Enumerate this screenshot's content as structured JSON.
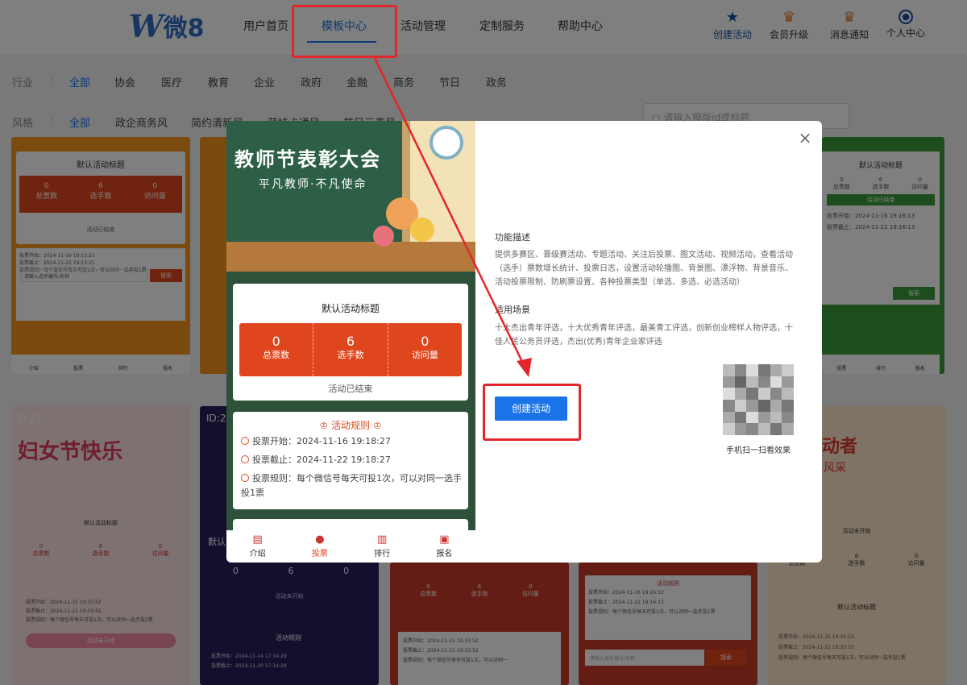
{
  "logo": {
    "mark": "W",
    "text": "微8"
  },
  "nav": {
    "items": [
      {
        "label": "用户首页"
      },
      {
        "label": "模板中心"
      },
      {
        "label": "活动管理"
      },
      {
        "label": "定制服务"
      },
      {
        "label": "帮助中心"
      }
    ]
  },
  "top_right": {
    "items": [
      {
        "label": "创建活动",
        "icon": "star-icon"
      },
      {
        "label": "会员升级",
        "icon": "crown-icon"
      },
      {
        "label": "消息通知",
        "icon": "bell-icon"
      },
      {
        "label": "个人中心",
        "icon": "user-icon"
      }
    ]
  },
  "filters": {
    "industry": {
      "label": "行业",
      "options": [
        "全部",
        "协会",
        "医疗",
        "教育",
        "企业",
        "政府",
        "金融",
        "商务",
        "节日",
        "政务"
      ]
    },
    "style": {
      "label": "风格",
      "options": [
        "全部",
        "政企商务风",
        "简约清新风",
        "萌娃卡通风",
        "节日元素风"
      ]
    },
    "search_placeholder": "请输入模版id或标题"
  },
  "background_cards": {
    "card1": {
      "title": "默认活动标题",
      "stats": [
        {
          "num": "0",
          "label": "总票数"
        },
        {
          "num": "6",
          "label": "选手数"
        },
        {
          "num": "0",
          "label": "访问量"
        }
      ],
      "status": "活动已结束",
      "start": "投票开始：2024-11-16 19:13:21",
      "end": "投票截止：2024-11-22 19:13:21",
      "rule": "投票规则：每个微信号每天可投1次，可以对同一选手投1票",
      "search_ph": "请输入选手编号/名称",
      "search_btn": "搜索",
      "nav": [
        "介绍",
        "投票",
        "排行",
        "报名"
      ]
    },
    "card_id21": {
      "id": "ID:21",
      "banner": "妇女节快乐",
      "title": "默认活动标题",
      "stats": [
        {
          "num": "0",
          "label": "总票数"
        },
        {
          "num": "6",
          "label": "选手数"
        },
        {
          "num": "0",
          "label": "访问量"
        }
      ],
      "start": "投票开始：2024-11-15 10:33:52",
      "end": "投票截止：2024-11-21 10:33:52",
      "rule": "投票规则：每个微信号每天可投1次，可以对同一选手投1票",
      "status": "活动未开始"
    },
    "card_id2": {
      "id": "ID:2",
      "label": "默认",
      "stats": [
        "0",
        "6",
        "0"
      ],
      "status": "活动未开始",
      "rules_title": "活动规则",
      "start": "投票开始：2024-11-14 17:14:29",
      "end": "投票截止：2024-11-20 17:14:29"
    },
    "card_mid": {
      "stats": [
        {
          "num": "0",
          "label": "总票数"
        },
        {
          "num": "6",
          "label": "选手数"
        },
        {
          "num": "0",
          "label": "访问量"
        }
      ],
      "start": "投票开始：2024-11-15 10:33:52",
      "end": "投票截止：2024-11-21 10:33:52",
      "rule": "投票规则：每个微信号每天可投1次，可以对同一"
    },
    "card_right_mid": {
      "rules_title": "活动规则",
      "start": "投票开始：2024-11-16 19:16:13",
      "end": "投票截止：2024-11-22 19:16:13",
      "rule": "投票规则：每个微信号每天可投1次，可以对同一选手投1票",
      "search_ph": "请输入选手编号/名称",
      "search_btn": "搜索"
    },
    "card_green": {
      "title": "默认活动标题",
      "stats": [
        {
          "num": "0",
          "label": "总票数"
        },
        {
          "num": "6",
          "label": "选手数"
        },
        {
          "num": "0",
          "label": "访问量"
        }
      ],
      "status": "活动已结束",
      "start": "投票开始：2024-11-16 19:16:13",
      "end": "投票截止：2024-11-22 19:16:13",
      "search_btn": "搜索",
      "nav": [
        "投票",
        "排行",
        "报名"
      ]
    },
    "card_far_right": {
      "banner": "动者",
      "sub": "风采",
      "status": "活动未开始",
      "stats": [
        {
          "num": "0",
          "label": "总票数"
        },
        {
          "num": "6",
          "label": "选手数"
        },
        {
          "num": "0",
          "label": "访问量"
        }
      ],
      "title": "默认活动标题",
      "start": "投票开始：2024-11-15 10:33:52",
      "end": "投票截止：2024-11-21 10:33:52",
      "rule": "投票规则：每个微信号每天可投1次，可以对同一选手投1票"
    }
  },
  "modal": {
    "preview": {
      "hero_title": "教师节表彰大会",
      "hero_sub": "平凡教师·不凡使命",
      "card_title": "默认活动标题",
      "stats": [
        {
          "num": "0",
          "label": "总票数"
        },
        {
          "num": "6",
          "label": "选手数"
        },
        {
          "num": "0",
          "label": "访问量"
        }
      ],
      "status": "活动已结束",
      "rules_title": "活动规则",
      "start": "投票开始：2024-11-16 19:18:27",
      "end": "投票截止：2024-11-22 19:18:27",
      "rule": "投票规则：每个微信号每天可投1次，可以对同一选手投1票",
      "nav": [
        {
          "label": "介绍",
          "icon": "doc-icon"
        },
        {
          "label": "投票",
          "icon": "user-icon"
        },
        {
          "label": "排行",
          "icon": "chart-icon"
        },
        {
          "label": "报名",
          "icon": "form-icon"
        }
      ]
    },
    "features_title": "功能描述",
    "features_text": "提供多赛区、晋级赛活动、专题活动、关注后投票、图文活动、视频活动，查看活动（选手）票数增长统计、投票日志，设置活动轮播图、背景图、漂浮物、背景音乐、活动投票限制、防刷票设置、各种投票类型（单选、多选、必选活动）",
    "scenes_title": "适用场景",
    "scenes_text": "十大杰出青年评选，十大优秀青年评选，最美青工评选，创新创业榜样人物评选，十佳人民公务员评选，杰出(优秀)青年企业家评选",
    "create_button": "创建活动",
    "qr_caption": "手机扫一扫看效果",
    "close_icon": "×"
  },
  "colors": {
    "accent": "#1a73e8",
    "highlight": "#e3262b",
    "stats_orange": "#e0461d",
    "preview_green": "#2e5239"
  }
}
